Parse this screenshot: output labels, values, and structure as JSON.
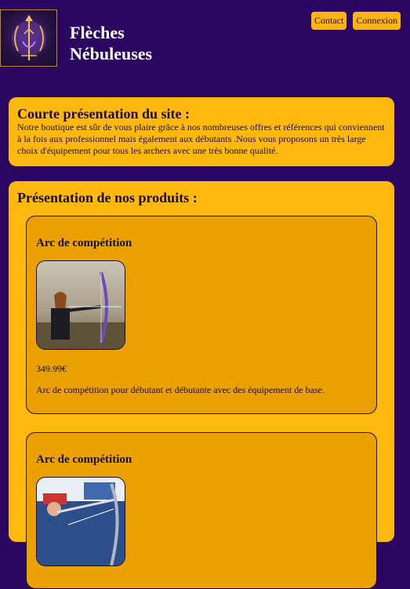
{
  "header": {
    "site_name_line1": "Flèches",
    "site_name_line2": "Nébuleuses",
    "nav": {
      "contact_label": "Contact",
      "login_label": "Connexion"
    }
  },
  "intro": {
    "title": "Courte présentation du site :",
    "text": "Notre boutique est sûr de vous plaire grâce à nos nombreuses offres et références qui conviennent à la fois aux professionnel mais également aux débutants .Nous vous proposons un très large choix d'équipement pour tous les archers avec une très bonne qualité."
  },
  "products": {
    "title": "Présentation de nos produits :",
    "items": [
      {
        "name": "Arc de compétition",
        "price": "349.99€",
        "description": "Arc de compétition pour débutant et débutante avec des équipement de base."
      },
      {
        "name": "Arc de compétition"
      }
    ]
  },
  "colors": {
    "background": "#2b0660",
    "accent": "#ffb80e",
    "card_inner": "#eaa000"
  }
}
